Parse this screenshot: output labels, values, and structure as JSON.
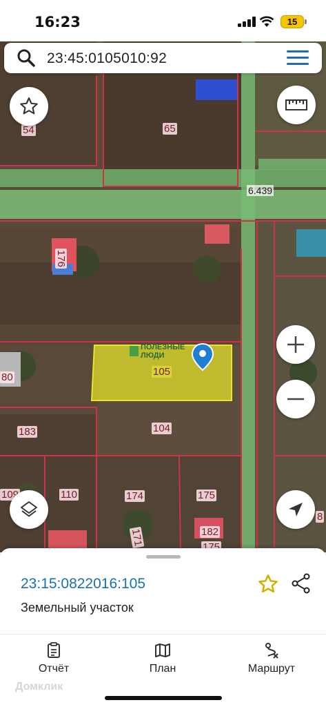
{
  "status_bar": {
    "time": "16:23",
    "battery": "15"
  },
  "search": {
    "query": "23:45:0105010:92"
  },
  "map": {
    "parcel_labels": [
      "54",
      "65",
      "176",
      "80",
      "105",
      "183",
      "104",
      "109",
      "110",
      "174",
      "175",
      "171",
      "182",
      "175",
      "8"
    ],
    "distance_label": "6.439",
    "watermark_logo": "ПОЛЕЗНЫЕ ЛЮДИ"
  },
  "details": {
    "cadastral_number": "23:15:0822016:105",
    "object_type": "Земельный участок"
  },
  "tabs": [
    {
      "label": "Отчёт",
      "icon": "report-icon"
    },
    {
      "label": "План",
      "icon": "map-plan-icon"
    },
    {
      "label": "Маршрут",
      "icon": "route-icon"
    }
  ],
  "bottom_watermark": "Домклик",
  "colors": {
    "accent": "#1f6fb0",
    "parcel_highlight": "#e6e62a",
    "boundary": "#d0324a",
    "star": "#d4b000"
  }
}
